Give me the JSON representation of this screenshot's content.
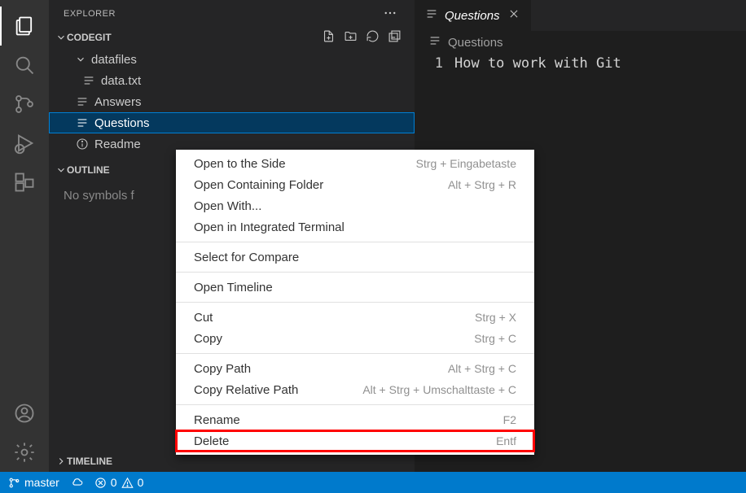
{
  "sidebar": {
    "title": "EXPLORER",
    "project": "CODEGIT",
    "tree": {
      "folder": "datafiles",
      "file1": "data.txt",
      "file2": "Answers",
      "file3": "Questions",
      "file4": "Readme"
    },
    "outline_title": "OUTLINE",
    "outline_empty": "No symbols f",
    "timeline_title": "TIMELINE"
  },
  "tabs": {
    "active": "Questions"
  },
  "breadcrumbs": {
    "item": "Questions"
  },
  "editor": {
    "line_number": "1",
    "line_text": "How to work with Git"
  },
  "context_menu": {
    "open_side": {
      "label": "Open to the Side",
      "shortcut": "Strg + Eingabetaste"
    },
    "open_folder": {
      "label": "Open Containing Folder",
      "shortcut": "Alt + Strg + R"
    },
    "open_with": {
      "label": "Open With..."
    },
    "open_terminal": {
      "label": "Open in Integrated Terminal"
    },
    "select_compare": {
      "label": "Select for Compare"
    },
    "open_timeline": {
      "label": "Open Timeline"
    },
    "cut": {
      "label": "Cut",
      "shortcut": "Strg + X"
    },
    "copy": {
      "label": "Copy",
      "shortcut": "Strg + C"
    },
    "copy_path": {
      "label": "Copy Path",
      "shortcut": "Alt + Strg + C"
    },
    "copy_rel_path": {
      "label": "Copy Relative Path",
      "shortcut": "Alt + Strg + Umschalttaste + C"
    },
    "rename": {
      "label": "Rename",
      "shortcut": "F2"
    },
    "delete": {
      "label": "Delete",
      "shortcut": "Entf"
    }
  },
  "status": {
    "branch": "master",
    "errors": "0",
    "warnings": "0"
  }
}
